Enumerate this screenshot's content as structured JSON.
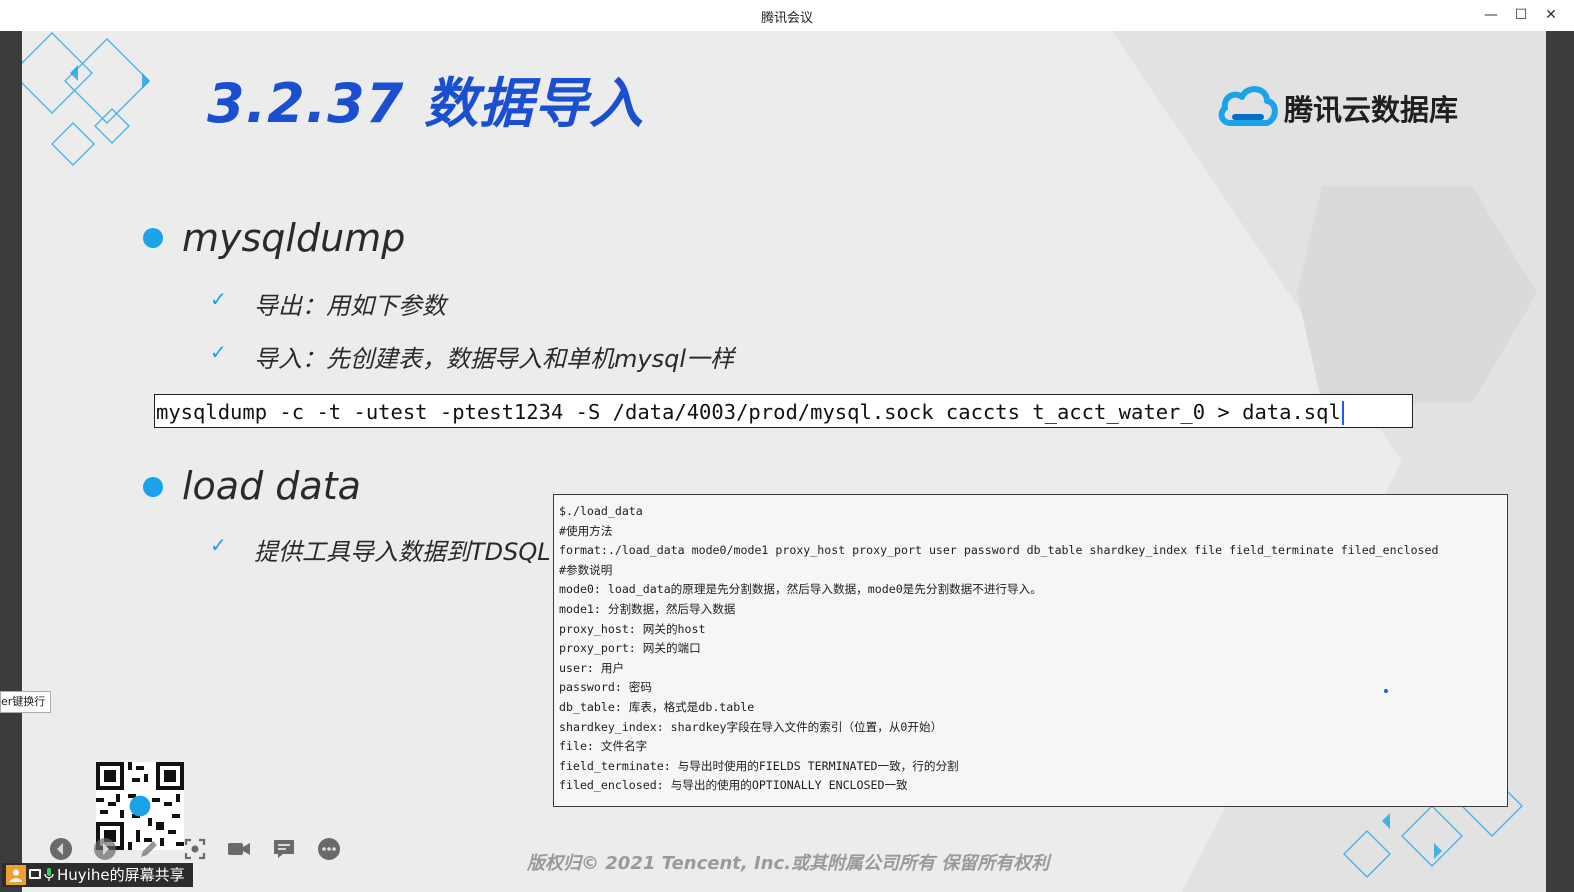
{
  "window": {
    "title": "腾讯会议",
    "minimize_glyph": "—",
    "maximize_glyph": "☐",
    "close_glyph": "✕"
  },
  "slide": {
    "title": "3.2.37 数据导入",
    "logo_text": "腾讯云数据库",
    "bullets": [
      {
        "label": "mysqldump"
      },
      {
        "label": "load data"
      }
    ],
    "sub_items": [
      "导出：用如下参数",
      "导入：先创建表，数据导入和单机mysql一样",
      "提供工具导入数据到TDSQL"
    ],
    "command": "mysqldump -c -t -utest -ptest1234 -S /data/4003/prod/mysql.sock caccts t_acct_water_0 > data.sql",
    "usage_lines": [
      "$./load_data",
      "#使用方法",
      "format:./load_data mode0/mode1 proxy_host proxy_port user password db_table shardkey_index file field_terminate filed_enclosed",
      "#参数说明",
      "mode0: load_data的原理是先分割数据，然后导入数据，mode0是先分割数据不进行导入。",
      "mode1: 分割数据，然后导入数据",
      "proxy_host: 网关的host",
      "proxy_port: 网关的端口",
      "user: 用户",
      "password: 密码",
      "db_table: 库表，格式是db.table",
      "shardkey_index: shardkey字段在导入文件的索引（位置，从0开始）",
      "file: 文件名字",
      "field_terminate: 与导出时使用的FIELDS TERMINATED一致，行的分割",
      "filed_enclosed: 与导出的使用的OPTIONALLY ENCLOSED一致"
    ],
    "footer": "版权归© 2021 Tencent, Inc.或其附属公司所有 保留所有权利"
  },
  "tooltip": "er键换行",
  "toolbar_icons": [
    "prev-icon",
    "next-icon",
    "pen-icon",
    "screenshot-icon",
    "video-icon",
    "chat-icon",
    "more-icon"
  ],
  "share": {
    "label": "Huyihe的屏幕共享"
  },
  "colors": {
    "accent": "#1aa3e8",
    "title_blue": "#1a4fcf"
  }
}
